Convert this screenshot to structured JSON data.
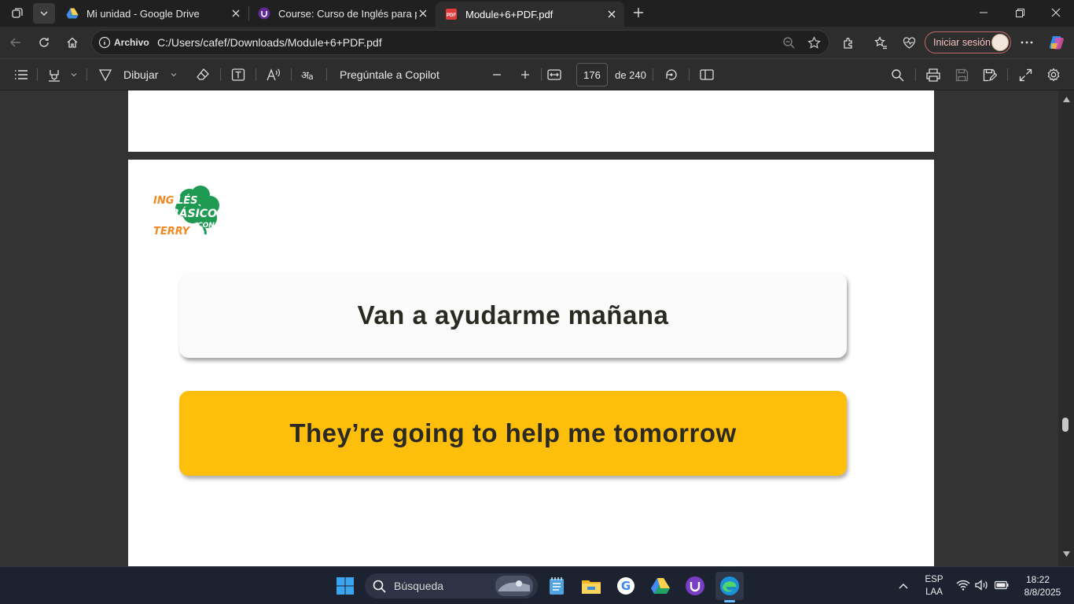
{
  "browser": {
    "tabs": [
      {
        "label": "Mi unidad - Google Drive",
        "icon": "google-drive-icon",
        "active": false
      },
      {
        "label": "Course: Curso de Inglés para principiantes",
        "icon": "udemy-icon",
        "active": false
      },
      {
        "label": "Module+6+PDF.pdf",
        "icon": "pdf-icon",
        "active": true
      }
    ],
    "address": {
      "site_label": "Archivo",
      "url": "C:/Users/cafef/Downloads/Module+6+PDF.pdf"
    },
    "signin_label": "Iniciar sesión"
  },
  "pdf_toolbar": {
    "draw_label": "Dibujar",
    "copilot_label": "Pregúntale a Copilot",
    "page_number": "176",
    "page_total": "de 240"
  },
  "document": {
    "logo_text": [
      "INGLÉS",
      "BÁSICO",
      "CON",
      "TERRY"
    ],
    "spanish_sentence": "Van a ayudarme mañana",
    "english_sentence": "They’re going to help me tomorrow"
  },
  "taskbar": {
    "search_placeholder": "Búsqueda",
    "lang_top": "ESP",
    "lang_bottom": "LAA",
    "time": "18:22",
    "date": "8/8/2025"
  },
  "colors": {
    "accent_yellow": "#fdbe0c",
    "logo_green": "#1e9a52",
    "logo_orange": "#f08a24"
  }
}
